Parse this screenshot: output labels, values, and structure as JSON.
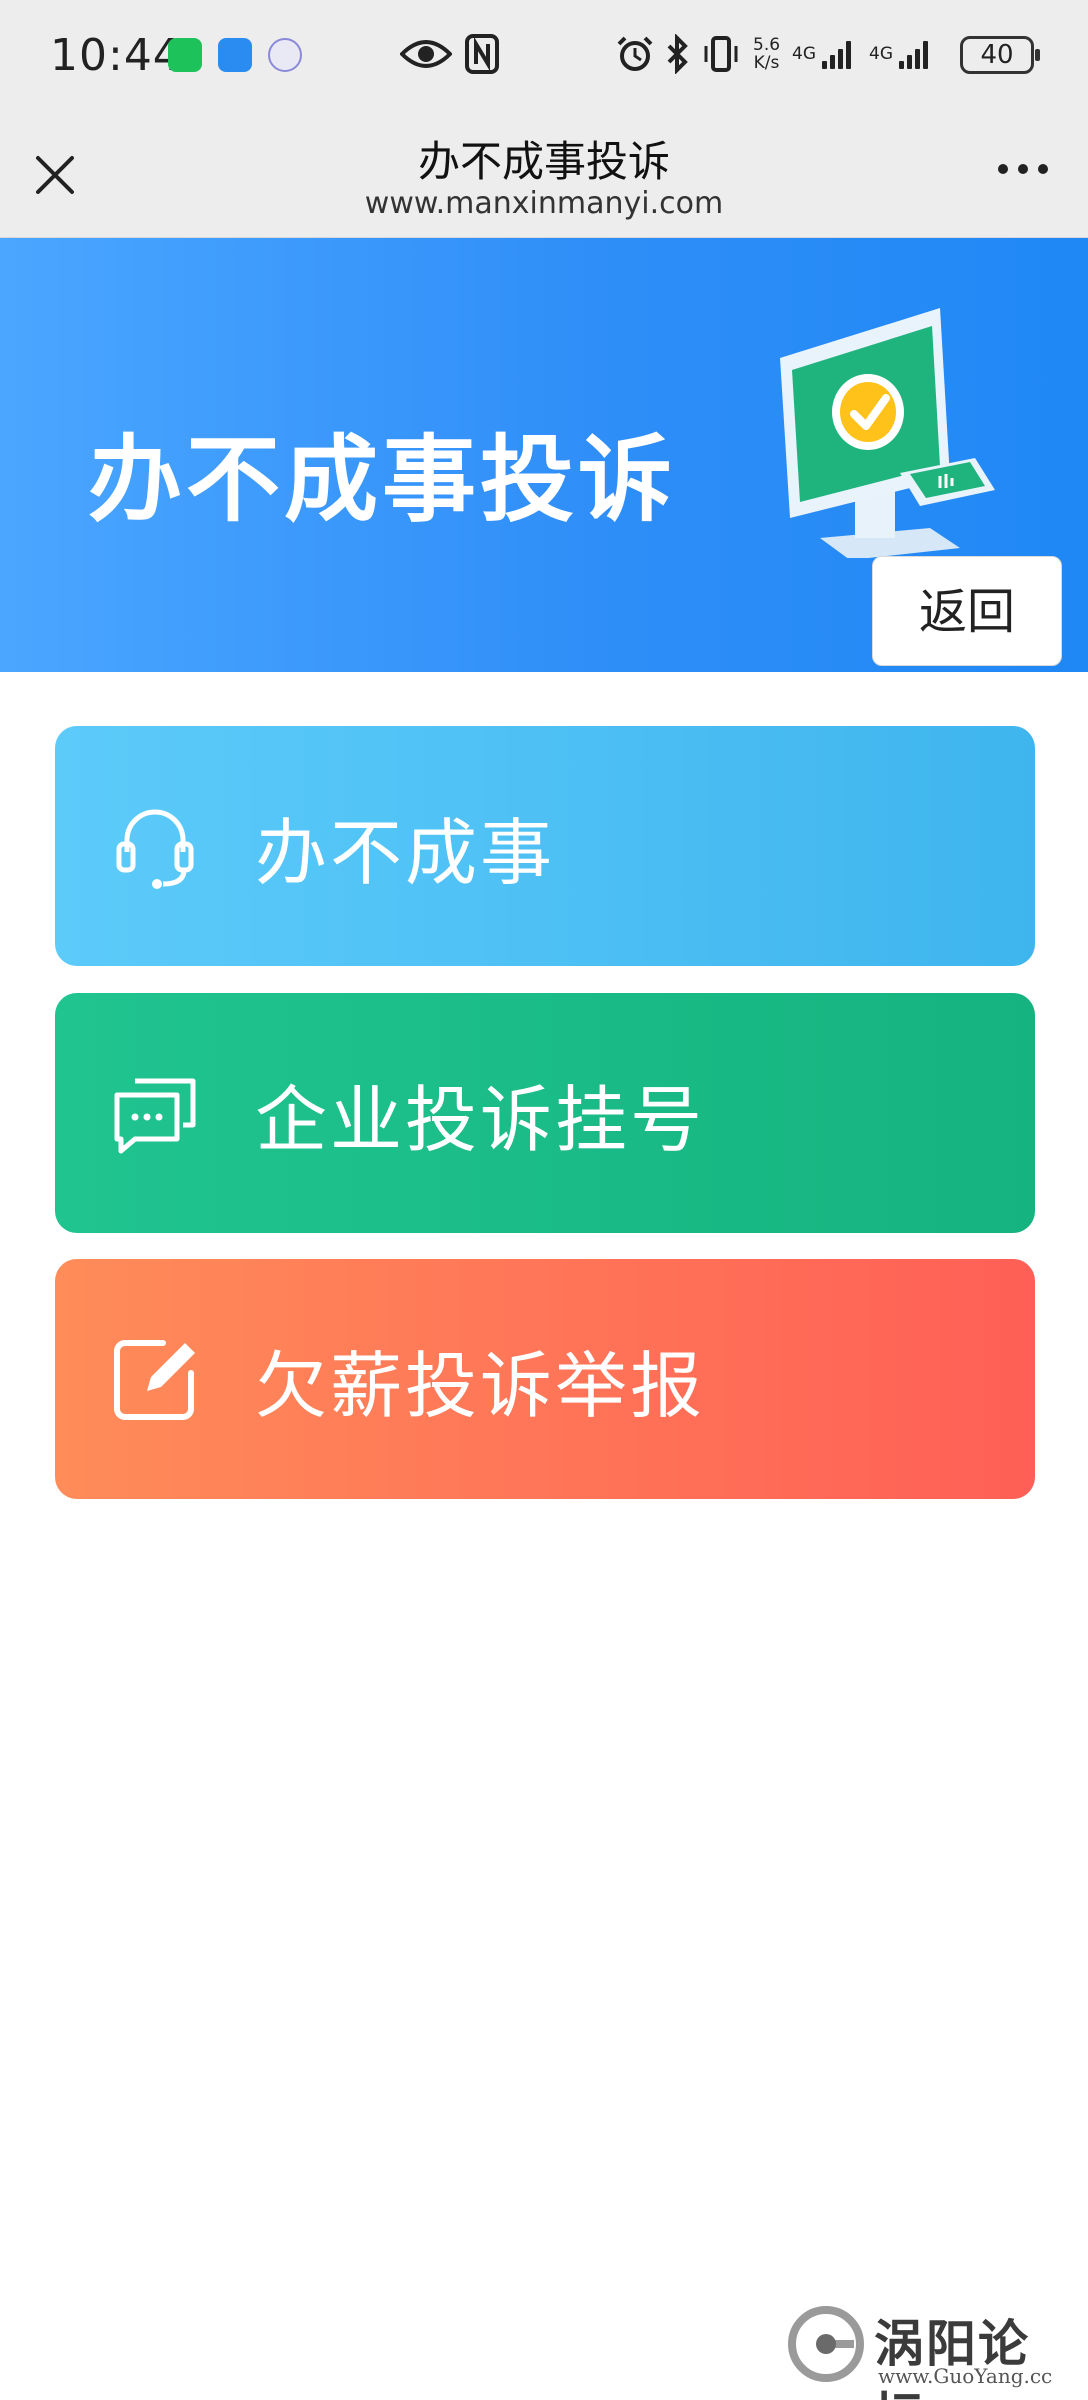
{
  "status_bar": {
    "time": "10:44",
    "speed_value": "5.6",
    "speed_unit": "K/s",
    "network_1": "4G",
    "network_2": "4G",
    "battery": "40",
    "icons": [
      "wechat-icon",
      "message-icon",
      "music-icon",
      "eye-icon",
      "nfc-icon",
      "alarm-icon",
      "bluetooth-icon",
      "vibrate-icon",
      "signal-icon",
      "signal-icon",
      "battery-icon"
    ]
  },
  "title_bar": {
    "title": "办不成事投诉",
    "url": "www.manxinmanyi.com",
    "icons": [
      "close-icon",
      "more-icon"
    ]
  },
  "banner": {
    "title": "办不成事投诉",
    "back_label": "返回",
    "colors": {
      "start": "#4aa6ff",
      "end": "#1f88f5"
    }
  },
  "menu": {
    "items": [
      {
        "label": "办不成事",
        "icon": "headset-icon",
        "color": "#4cc0f3"
      },
      {
        "label": "企业投诉挂号",
        "icon": "chat-bubbles-icon",
        "color": "#1bbd88"
      },
      {
        "label": "欠薪投诉举报",
        "icon": "edit-icon",
        "color": "#ff7657"
      }
    ]
  },
  "watermark": {
    "text": "涡阳论坛",
    "sub": "www.GuoYang.cc"
  }
}
